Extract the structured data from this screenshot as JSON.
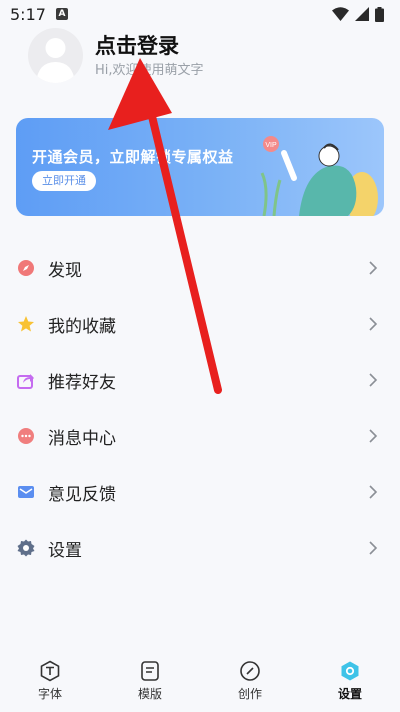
{
  "status_bar": {
    "time": "5:17",
    "notification_icon": "A"
  },
  "profile": {
    "title": "点击登录",
    "subtitle": "Hi,欢迎使用萌文字"
  },
  "vip": {
    "text": "开通会员，立即解锁专属权益",
    "button": "立即开通",
    "badge": "VIP"
  },
  "menu": [
    {
      "label": "发现",
      "icon": "compass-icon",
      "color": "#f07878"
    },
    {
      "label": "我的收藏",
      "icon": "star-icon",
      "color": "#f8c234"
    },
    {
      "label": "推荐好友",
      "icon": "share-icon",
      "color": "#c56cf0"
    },
    {
      "label": "消息中心",
      "icon": "message-icon",
      "color": "#f07e7e"
    },
    {
      "label": "意见反馈",
      "icon": "mail-icon",
      "color": "#5b8ef0"
    },
    {
      "label": "设置",
      "icon": "gear-icon",
      "color": "#5f6f8a"
    }
  ],
  "tabs": [
    {
      "label": "字体",
      "icon": "font-icon"
    },
    {
      "label": "模版",
      "icon": "template-icon"
    },
    {
      "label": "创作",
      "icon": "create-icon"
    },
    {
      "label": "设置",
      "icon": "settings-tab-icon",
      "active": true
    }
  ],
  "colors": {
    "accent": "#5e9df5",
    "arrow": "#e8201e",
    "tab_active": "#3ec3e8"
  }
}
